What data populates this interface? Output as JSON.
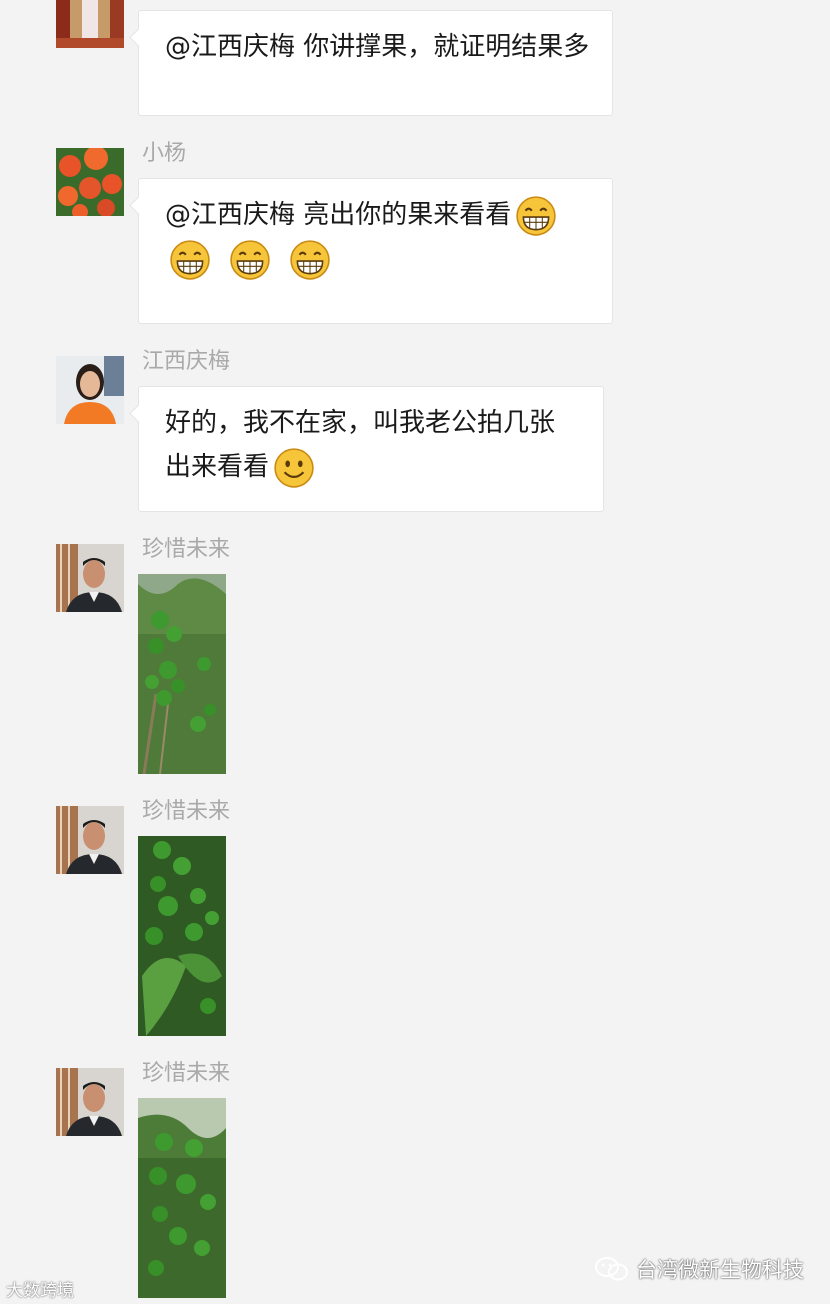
{
  "messages": [
    {
      "sender": "",
      "text": "@江西庆梅 你讲撑果，就证明结果多"
    },
    {
      "sender": "小杨",
      "text": "@江西庆梅 亮出你的果来看看"
    },
    {
      "sender": "江西庆梅",
      "text_line1": "好的，我不在家，叫我老公拍几张",
      "text_line2": "出来看看"
    },
    {
      "sender": "珍惜未来"
    },
    {
      "sender": "珍惜未来"
    },
    {
      "sender": "珍惜未来"
    }
  ],
  "icons": {
    "grin": "grin-emoji-icon",
    "smile": "smile-emoji-icon",
    "wechat": "wechat-icon"
  },
  "watermark": {
    "left": "大数跨境",
    "right": "台湾微新生物科技"
  },
  "colors": {
    "background": "#f3f3f3",
    "bubble": "#ffffff",
    "sender": "#a9a9a9",
    "orange": "#e8532a",
    "green_fruit": "#3e9a2f"
  }
}
